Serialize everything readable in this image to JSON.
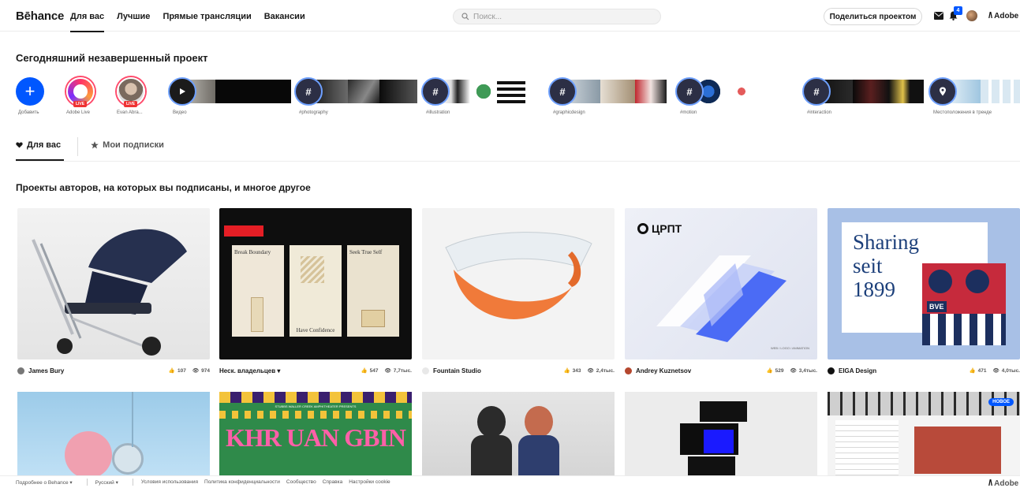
{
  "header": {
    "logo": "Bēhance",
    "tabs": [
      {
        "label": "Для вас"
      },
      {
        "label": "Лучшие"
      },
      {
        "label": "Прямые трансляции"
      },
      {
        "label": "Вакансии"
      }
    ],
    "search_placeholder": "Поиск...",
    "share_label": "Поделиться проектом",
    "notif_count": "4",
    "adobe_label": "Adobe"
  },
  "today": {
    "title": "Сегодняшний незавершенный проект",
    "stories": [
      {
        "label": "Добавить",
        "kind": "add"
      },
      {
        "label": "Adobe Live",
        "kind": "live",
        "tag": "LIVE"
      },
      {
        "label": "Evan Abra...",
        "kind": "live",
        "tag": "LIVE"
      },
      {
        "label": "Видео",
        "kind": "video"
      },
      {
        "label": "#photography",
        "kind": "tag",
        "glyph": "#"
      },
      {
        "label": "#illustration",
        "kind": "tag",
        "glyph": "#"
      },
      {
        "label": "#graphicdesign",
        "kind": "tag",
        "glyph": "#"
      },
      {
        "label": "#motion",
        "kind": "tag",
        "glyph": "#"
      },
      {
        "label": "#interaction",
        "kind": "tag",
        "glyph": "#"
      },
      {
        "label": "Местоположения в тренде",
        "kind": "location"
      }
    ]
  },
  "feed_tabs": [
    {
      "label": "Для вас",
      "icon": "heart-icon"
    },
    {
      "label": "Мои подписки",
      "icon": "star-icon"
    }
  ],
  "subtitle": "Проекты авторов, на которых вы подписаны, и многое другое",
  "projects": [
    {
      "owner": "James Bury",
      "likes": "107",
      "views": "974"
    },
    {
      "owner": "Неск. владельцев ▾",
      "likes": "547",
      "views": "7,7тыс."
    },
    {
      "owner": "Fountain Studio",
      "likes": "343",
      "views": "2,4тыс."
    },
    {
      "owner": "Andrey Kuznetsov",
      "likes": "529",
      "views": "3,4тыс."
    },
    {
      "owner": "EIGA Design",
      "likes": "471",
      "views": "4,0тыс."
    }
  ],
  "card_texts": {
    "if_break": "Break Boundary",
    "if_seek": "Seek True Self",
    "if_have": "Have Confidence",
    "cprt_logo": "ЦРПТ",
    "cprt_caption": "WEB / LOGO / ANIMATION",
    "eiga_line1": "Sharing",
    "eiga_line2": "seit",
    "eiga_line3": "1899",
    "eiga_bve": "BVE",
    "khr_small": "STUBBS WALLER CREEK AMPHITHEATER PRESENTS",
    "khr_title": "KHR UAN GBIN",
    "new_badge": "НОВОЕ"
  },
  "footer": {
    "items": [
      "Подробнее о Behance ▾",
      "Русский ▾",
      "Условия использования",
      "Политика конфиденциальности",
      "Сообщество",
      "Справка",
      "Настройки cookie"
    ],
    "adobe": "Adobe"
  }
}
